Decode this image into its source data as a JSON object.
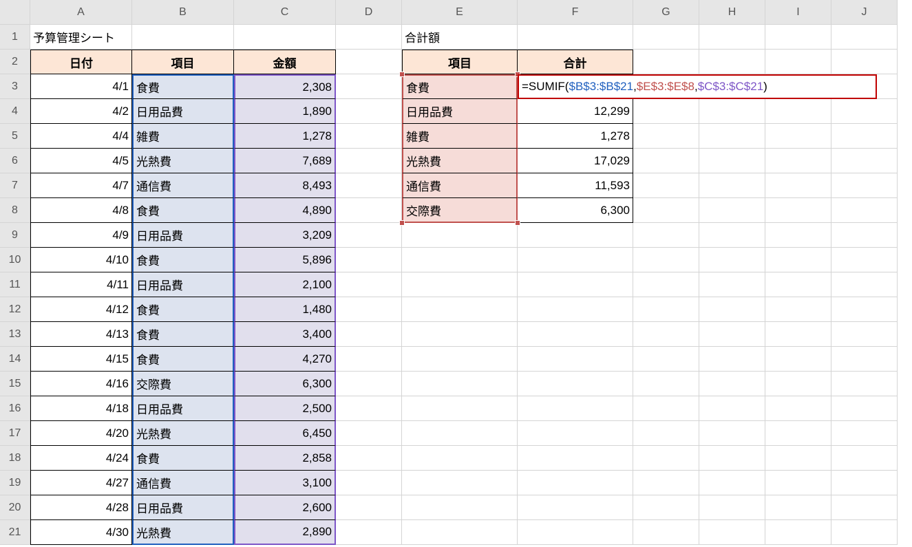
{
  "columns": [
    "A",
    "B",
    "C",
    "D",
    "E",
    "F",
    "G",
    "H",
    "I",
    "J"
  ],
  "rows": 21,
  "title_cell": "予算管理シート",
  "summary_title": "合計額",
  "left_headers": {
    "date": "日付",
    "item": "項目",
    "amount": "金額"
  },
  "right_headers": {
    "item": "項目",
    "sum": "合計"
  },
  "left_data": [
    {
      "date": "4/1",
      "item": "食費",
      "amount": "2,308"
    },
    {
      "date": "4/2",
      "item": "日用品費",
      "amount": "1,890"
    },
    {
      "date": "4/4",
      "item": "雑費",
      "amount": "1,278"
    },
    {
      "date": "4/5",
      "item": "光熱費",
      "amount": "7,689"
    },
    {
      "date": "4/7",
      "item": "通信費",
      "amount": "8,493"
    },
    {
      "date": "4/8",
      "item": "食費",
      "amount": "4,890"
    },
    {
      "date": "4/9",
      "item": "日用品費",
      "amount": "3,209"
    },
    {
      "date": "4/10",
      "item": "食費",
      "amount": "5,896"
    },
    {
      "date": "4/11",
      "item": "日用品費",
      "amount": "2,100"
    },
    {
      "date": "4/12",
      "item": "食費",
      "amount": "1,480"
    },
    {
      "date": "4/13",
      "item": "食費",
      "amount": "3,400"
    },
    {
      "date": "4/15",
      "item": "食費",
      "amount": "4,270"
    },
    {
      "date": "4/16",
      "item": "交際費",
      "amount": "6,300"
    },
    {
      "date": "4/18",
      "item": "日用品費",
      "amount": "2,500"
    },
    {
      "date": "4/20",
      "item": "光熱費",
      "amount": "6,450"
    },
    {
      "date": "4/24",
      "item": "食費",
      "amount": "2,858"
    },
    {
      "date": "4/27",
      "item": "通信費",
      "amount": "3,100"
    },
    {
      "date": "4/28",
      "item": "日用品費",
      "amount": "2,600"
    },
    {
      "date": "4/30",
      "item": "光熱費",
      "amount": "2,890"
    }
  ],
  "right_data": [
    {
      "item": "食費",
      "sum": ""
    },
    {
      "item": "日用品費",
      "sum": "12,299"
    },
    {
      "item": "雑費",
      "sum": "1,278"
    },
    {
      "item": "光熱費",
      "sum": "17,029"
    },
    {
      "item": "通信費",
      "sum": "11,593"
    },
    {
      "item": "交際費",
      "sum": "6,300"
    }
  ],
  "formula": {
    "prefix": "=SUMIF(",
    "arg1": "$B$3:$B$21",
    "arg2": "$E$3:$E$8",
    "arg3": "$C$3:$C$21",
    "sep": ",",
    "suffix": ")"
  }
}
